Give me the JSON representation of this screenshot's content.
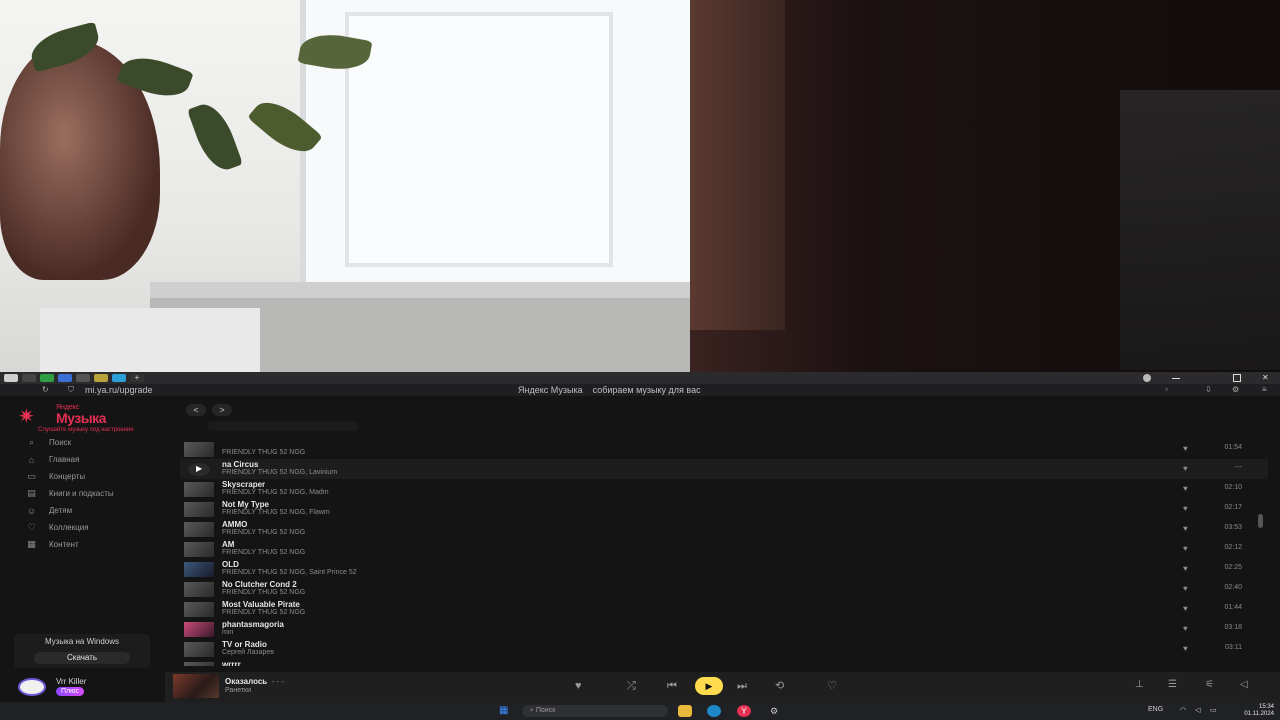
{
  "browser": {
    "url": "mi.ya.ru/upgrade",
    "page_title": "Яндекс Музыка",
    "page_subtitle": "собираем музыку для вас"
  },
  "app": {
    "logo_small": "Яндекс",
    "logo_big": "Музыка",
    "logo_sub": "Слушайте музыку под настроение",
    "nav": [
      {
        "label": "Поиск",
        "icon": "search-icon"
      },
      {
        "label": "Главная",
        "icon": "home-icon"
      },
      {
        "label": "Концерты",
        "icon": "ticket-icon"
      },
      {
        "label": "Книги и подкасты",
        "icon": "book-icon"
      },
      {
        "label": "Детям",
        "icon": "kids-icon"
      },
      {
        "label": "Коллекция",
        "icon": "heart-icon"
      },
      {
        "label": "Контент",
        "icon": "grid-icon"
      }
    ],
    "promo": {
      "title": "Музыка на Windows",
      "button": "Скачать"
    },
    "user": {
      "name": "Vrr Killer",
      "badge": "Плюс"
    },
    "back_label": "<",
    "forward_label": ">"
  },
  "tracks": [
    {
      "title": "",
      "artist": "FRIENDLY THUG 52 NGG",
      "duration": "01:54",
      "thumb": "gray",
      "state": ""
    },
    {
      "title": "na Circus",
      "artist": "FRIENDLY THUG 52 NGG, Lavinium",
      "duration": "---",
      "thumb": "play",
      "state": "active"
    },
    {
      "title": "Skyscraper",
      "artist": "FRIENDLY THUG 52 NGG, Madm",
      "duration": "02:10",
      "thumb": "gray",
      "state": ""
    },
    {
      "title": "Not My Type",
      "artist": "FRIENDLY THUG 52 NGG, Flawm",
      "duration": "02:17",
      "thumb": "gray",
      "state": ""
    },
    {
      "title": "AMMO",
      "artist": "FRIENDLY THUG 52 NGG",
      "duration": "03:53",
      "thumb": "gray",
      "state": ""
    },
    {
      "title": "AM",
      "artist": "FRIENDLY THUG 52 NGG",
      "duration": "02:12",
      "thumb": "gray",
      "state": ""
    },
    {
      "title": "OLD",
      "artist": "FRIENDLY THUG 52 NGG, Saint Prince 52",
      "duration": "02:25",
      "thumb": "blue",
      "state": ""
    },
    {
      "title": "No Clutcher Cond 2",
      "artist": "FRIENDLY THUG 52 NGG",
      "duration": "02:40",
      "thumb": "gray",
      "state": ""
    },
    {
      "title": "Most Valuable Pirate",
      "artist": "FRIENDLY THUG 52 NGG",
      "duration": "01:44",
      "thumb": "gray",
      "state": ""
    },
    {
      "title": "phantasmagoria",
      "artist": "miri",
      "duration": "03:18",
      "thumb": "pink",
      "state": ""
    },
    {
      "title": "TV or Radio",
      "artist": "Сергей Лазарев",
      "duration": "03:11",
      "thumb": "gray",
      "state": ""
    },
    {
      "title": "wrrrr",
      "artist": "",
      "duration": "",
      "thumb": "gray",
      "state": ""
    }
  ],
  "player": {
    "title": "Оказалось",
    "artist": "Ранетки",
    "extra": "- - -"
  },
  "taskbar": {
    "search_placeholder": "Поиск",
    "lang": "ENG",
    "time": "15:34",
    "date": "01.11.2024"
  },
  "colors": {
    "accent_yellow": "#ffdb4d",
    "logo_red": "#e33052",
    "plus_purple": "#8b46ff"
  }
}
